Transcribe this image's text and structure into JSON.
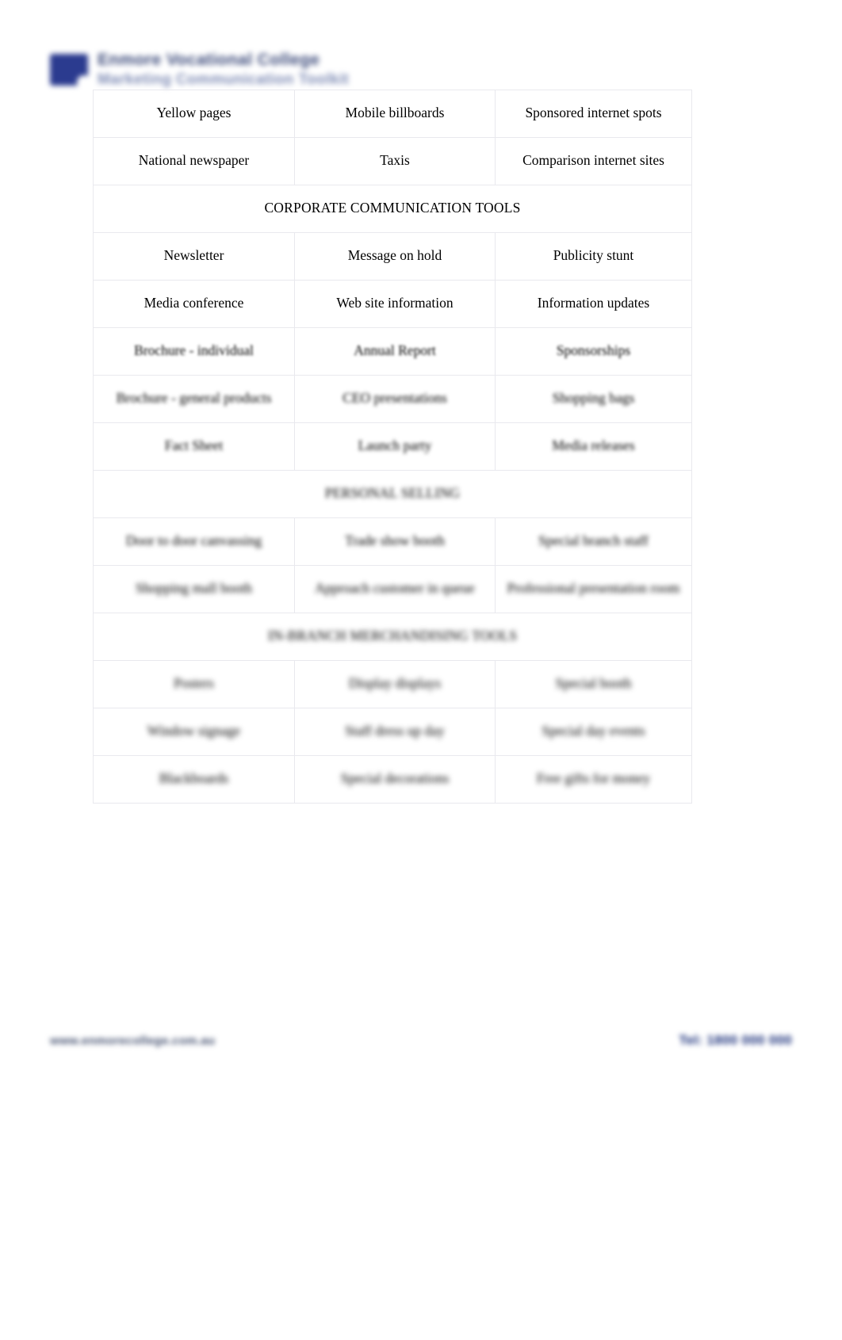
{
  "document": {
    "header": {
      "logo_line1": "Enmore Vocational College",
      "logo_line2": "Marketing Communication Toolkit"
    },
    "footer": {
      "website": "www.enmorecollege.com.au",
      "telephone": "Tel: 1800 000 000"
    },
    "table": {
      "columns": 3,
      "rows": [
        {
          "type": "data",
          "blur": "b0",
          "cells": [
            "Yellow pages",
            "Mobile billboards",
            "Sponsored internet spots"
          ]
        },
        {
          "type": "data",
          "blur": "b0",
          "cells": [
            "National newspaper",
            "Taxis",
            "Comparison internet sites"
          ]
        },
        {
          "type": "section",
          "blur": "b0",
          "title": "CORPORATE COMMUNICATION TOOLS"
        },
        {
          "type": "data",
          "blur": "b0",
          "cells": [
            "Newsletter",
            "Message on hold",
            "Publicity stunt"
          ]
        },
        {
          "type": "data",
          "blur": "b1",
          "cells": [
            "Media conference",
            "Web site information",
            "Information updates"
          ]
        },
        {
          "type": "data",
          "blur": "b2",
          "cells": [
            "Brochure - individual",
            "Annual Report",
            "Sponsorships"
          ]
        },
        {
          "type": "data",
          "blur": "b3",
          "cells": [
            "Brochure - general products",
            "CEO presentations",
            "Shopping bags"
          ]
        },
        {
          "type": "data",
          "blur": "b3",
          "cells": [
            "Fact Sheet",
            "Launch party",
            "Media releases"
          ]
        },
        {
          "type": "section",
          "blur": "b4",
          "title": "PERSONAL SELLING"
        },
        {
          "type": "data",
          "blur": "b4",
          "cells": [
            "Door to door canvassing",
            "Trade show booth",
            "Special branch staff"
          ]
        },
        {
          "type": "data",
          "blur": "b5",
          "cells": [
            "Shopping mall booth",
            "Approach customer in queue",
            "Professional presentation room"
          ]
        },
        {
          "type": "section",
          "blur": "b5",
          "title": "IN-BRANCH MERCHANDISING TOOLS"
        },
        {
          "type": "data",
          "blur": "b6",
          "cells": [
            "Posters",
            "Display displays",
            "Special booth"
          ]
        },
        {
          "type": "data",
          "blur": "b6",
          "cells": [
            "Window signage",
            "Staff dress up day",
            "Special day events"
          ]
        },
        {
          "type": "data",
          "blur": "b6",
          "cells": [
            "Blackboards",
            "Special decorations",
            "Free gifts for money"
          ]
        }
      ]
    }
  }
}
